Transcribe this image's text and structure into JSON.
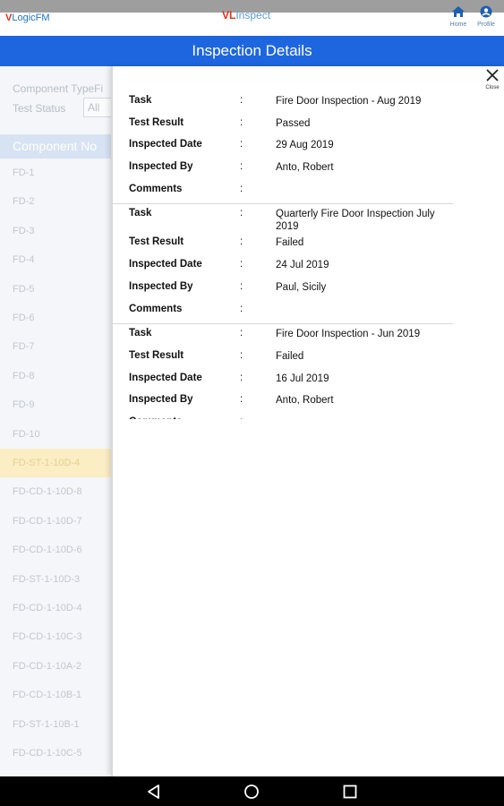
{
  "app": {
    "logo_left_v": "V",
    "logo_left_rest": "LogicFM",
    "logo_center_v": "VL",
    "logo_center_rest": "Inspect",
    "home_label": "Home",
    "profile_label": "Profile"
  },
  "title": "Inspection Details",
  "background": {
    "filter_type_label": "Component TypeFi",
    "test_status_label": "Test Status",
    "test_status_value": "All",
    "column_header": "Component No",
    "rows": [
      "FD-1",
      "FD-2",
      "FD-3",
      "FD-4",
      "FD-5",
      "FD-6",
      "FD-7",
      "FD-8",
      "FD-9",
      "FD-10",
      "FD-ST-1-10D-4",
      "FD-CD-1-10D-8",
      "FD-CD-1-10D-7",
      "FD-CD-1-10D-6",
      "FD-ST-1-10D-3",
      "FD-CD-1-10D-4",
      "FD-CD-1-10C-3",
      "FD-CD-1-10A-2",
      "FD-CD-1-10B-1",
      "FD-ST-1-10B-1",
      "FD-CD-1-10C-5"
    ]
  },
  "modal": {
    "close_label": "Close",
    "labels": {
      "task": "Task",
      "test_result": "Test Result",
      "inspected_date": "Inspected Date",
      "inspected_by": "Inspected By",
      "comments": "Comments",
      "colon": ":"
    },
    "records": [
      {
        "task": "Fire Door Inspection - Aug 2019",
        "test_result": "Passed",
        "inspected_date": "29 Aug 2019",
        "inspected_by": "Anto, Robert",
        "comments": ""
      },
      {
        "task": "Quarterly Fire Door Inspection July 2019",
        "test_result": "Failed",
        "inspected_date": "24 Jul 2019",
        "inspected_by": "Paul, Sicily",
        "comments": ""
      },
      {
        "task": "Fire Door Inspection - Jun 2019",
        "test_result": "Failed",
        "inspected_date": "16 Jul 2019",
        "inspected_by": "Anto, Robert",
        "comments": ""
      }
    ]
  },
  "colors": {
    "title_bar": "#1e66e0",
    "highlight_row": "#fbeec4"
  }
}
